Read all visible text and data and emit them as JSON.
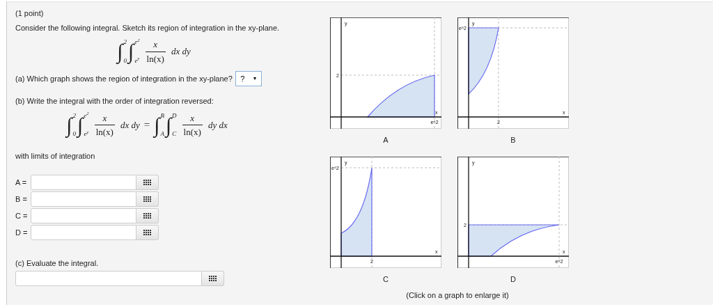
{
  "points": "(1 point)",
  "prompt": "Consider the following integral. Sketch its region of integration in the xy-plane.",
  "integral": {
    "integrals": [
      {
        "symbol": "∫",
        "lower": "0",
        "upper": "2"
      },
      {
        "symbol": "∫",
        "lower": "e$^{y}$",
        "upper": "e$^{2}$"
      }
    ],
    "numerator": "x",
    "denominator": "ln(x)",
    "differentials": "dx dy"
  },
  "part_a": {
    "question": "(a) Which graph shows the region of integration in the xy-plane?",
    "dropdown": {
      "value": "?",
      "caret": "▾"
    }
  },
  "part_b": {
    "question": "(b) Write the integral with the order of integration reversed:",
    "equation": {
      "left": {
        "integrals": [
          {
            "symbol": "∫",
            "lower": "0",
            "upper": "2"
          },
          {
            "symbol": "∫",
            "lower": "e$^{y}$",
            "upper": "e$^{2}$"
          }
        ],
        "numerator": "x",
        "denominator": "ln(x)",
        "differentials": "dx dy"
      },
      "equals": "=",
      "right": {
        "integrals": [
          {
            "symbol": "∫",
            "lower": "A",
            "upper": "B"
          },
          {
            "symbol": "∫",
            "lower": "C",
            "upper": "D"
          }
        ],
        "numerator": "x",
        "denominator": "ln(x)",
        "differentials": "dy dx"
      }
    },
    "limits_label": "with limits of integration",
    "limits": [
      {
        "label": "A ="
      },
      {
        "label": "B ="
      },
      {
        "label": "C ="
      },
      {
        "label": "D ="
      }
    ]
  },
  "part_c": {
    "question": "(c) Evaluate the integral."
  },
  "graphs": [
    {
      "kind": "lowerright",
      "caption": "A",
      "y_label": "y",
      "x_label": "x",
      "y_tick": "2",
      "x_tick": "e^2"
    },
    {
      "kind": "upperleft",
      "caption": "B",
      "y_label": "y",
      "x_label": "x",
      "y_tick": "e^2",
      "x_tick": "2"
    },
    {
      "kind": "leftband",
      "caption": "C",
      "y_label": "y",
      "x_label": "x",
      "y_tick": "e^2",
      "x_tick": "2"
    },
    {
      "kind": "lowerband",
      "caption": "D",
      "y_label": "y",
      "x_label": "x",
      "y_tick": "2",
      "x_tick": "e^2"
    }
  ],
  "graphs_hint": "(Click on a graph to enlarge it)"
}
